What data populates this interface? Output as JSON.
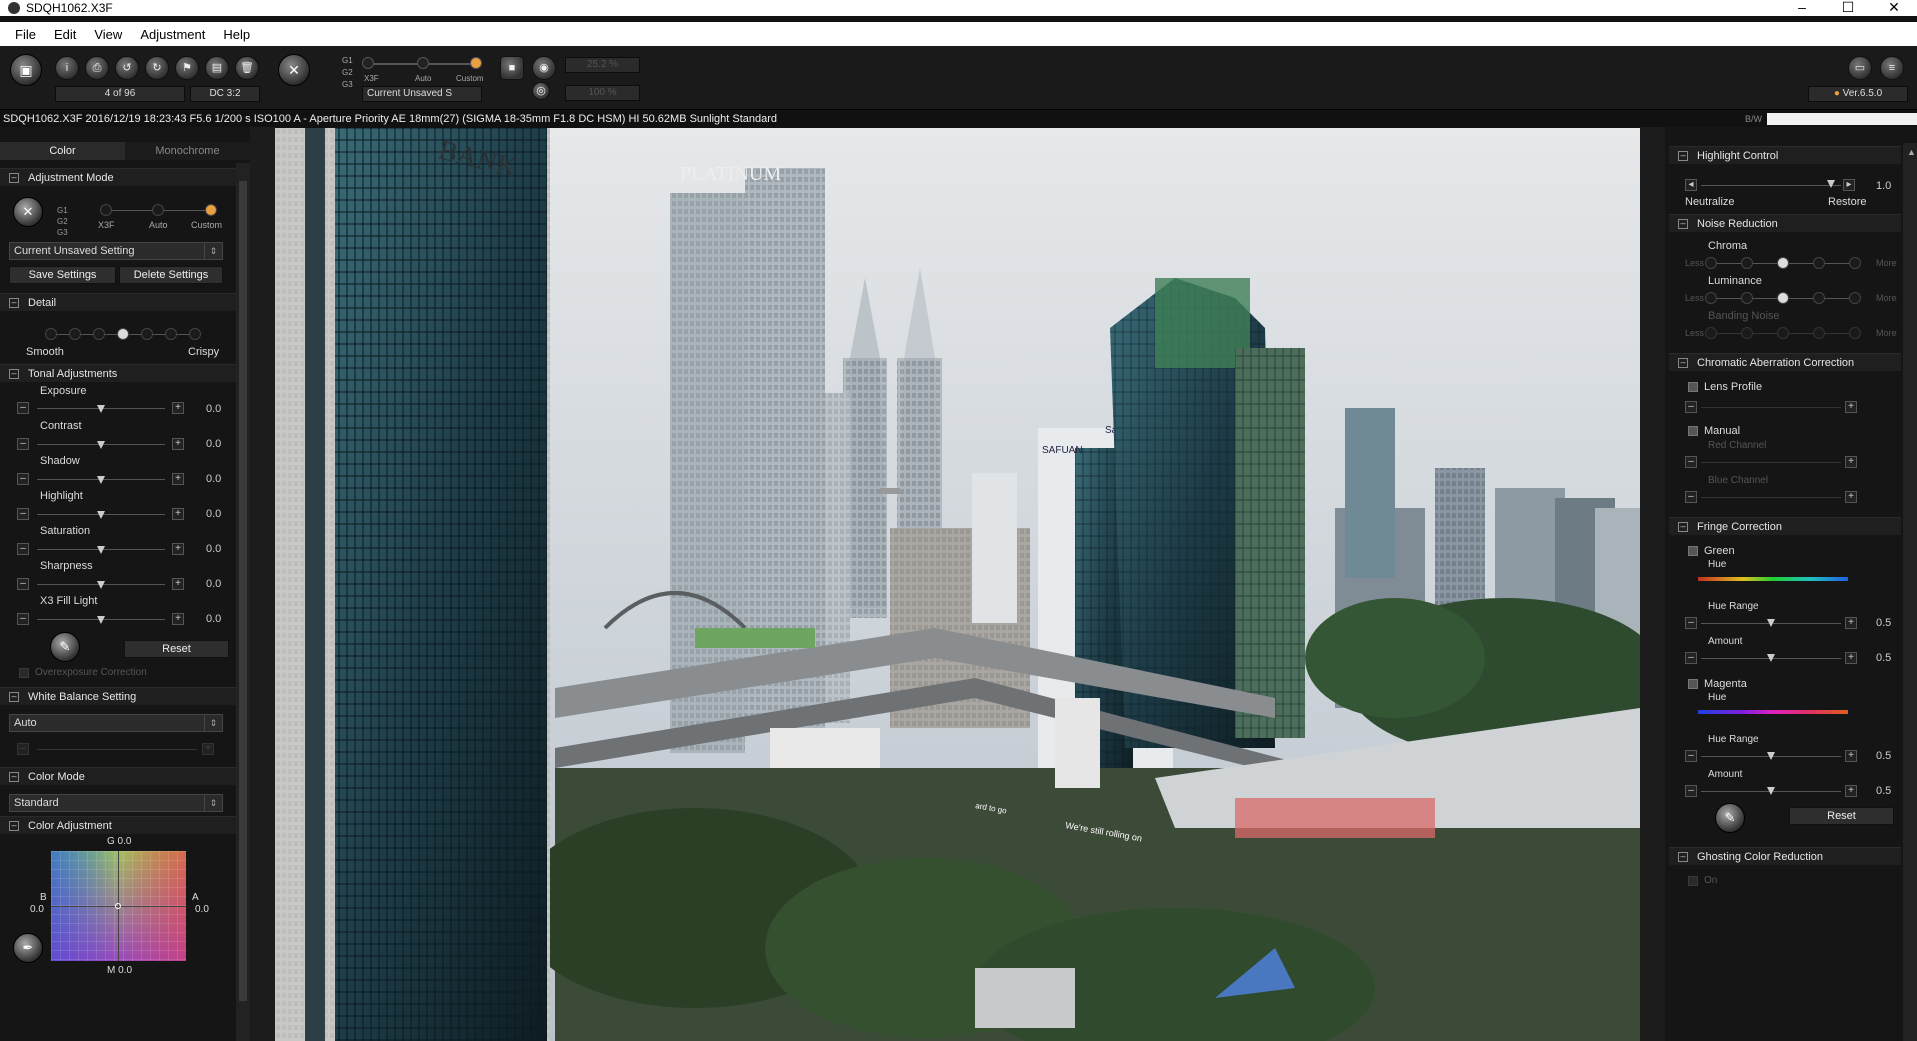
{
  "window": {
    "title": "SDQH1062.X3F",
    "controls": [
      "–",
      "☐",
      "✕"
    ]
  },
  "menu": [
    "File",
    "Edit",
    "View",
    "Adjustment",
    "Help"
  ],
  "toolbar": {
    "counter": "4 of 96",
    "aspect": "DC 3:2",
    "mode_labels": [
      "X3F",
      "Auto",
      "Custom"
    ],
    "g_labels": [
      "G1",
      "G2",
      "G3"
    ],
    "setting": "Current Unsaved S",
    "zoom1": "25.2 %",
    "zoom2": "100 %",
    "version": "Ver.6.5.0"
  },
  "info": {
    "text": "SDQH1062.X3F 2016/12/19 18:23:43 F5.6 1/200 s ISO100 A - Aperture Priority AE 18mm(27) (SIGMA 18-35mm F1.8 DC HSM) HI 50.62MB Sunlight Standard",
    "bw_label": "B/W"
  },
  "left": {
    "tabs": [
      "Color",
      "Monochrome"
    ],
    "adjustment_mode": {
      "title": "Adjustment Mode",
      "g_labels": [
        "G1",
        "G2",
        "G3"
      ],
      "labels": [
        "X3F",
        "Auto",
        "Custom"
      ],
      "setting": "Current Unsaved Setting",
      "save": "Save Settings",
      "delete": "Delete Settings"
    },
    "detail": {
      "title": "Detail",
      "smooth": "Smooth",
      "crispy": "Crispy"
    },
    "tonal": {
      "title": "Tonal Adjustments",
      "items": [
        {
          "label": "Exposure",
          "value": "0.0"
        },
        {
          "label": "Contrast",
          "value": "0.0"
        },
        {
          "label": "Shadow",
          "value": "0.0"
        },
        {
          "label": "Highlight",
          "value": "0.0"
        },
        {
          "label": "Saturation",
          "value": "0.0"
        },
        {
          "label": "Sharpness",
          "value": "0.0"
        },
        {
          "label": "X3 Fill Light",
          "value": "0.0"
        }
      ],
      "reset": "Reset",
      "overexposure": "Overexposure Correction"
    },
    "wb": {
      "title": "White Balance Setting",
      "value": "Auto"
    },
    "color_mode": {
      "title": "Color Mode",
      "value": "Standard"
    },
    "color_adj": {
      "title": "Color Adjustment",
      "g_label": "G 0.0",
      "b_label": "B",
      "b_value": "0.0",
      "a_label": "A",
      "a_value": "0.0",
      "m_label": "M 0.0"
    }
  },
  "right": {
    "highlight": {
      "title": "Highlight Control",
      "value": "1.0",
      "neutralize": "Neutralize",
      "restore": "Restore"
    },
    "noise": {
      "title": "Noise Reduction",
      "chroma": "Chroma",
      "luminance": "Luminance",
      "banding": "Banding Noise",
      "less": "Less",
      "more": "More"
    },
    "chromatic": {
      "title": "Chromatic Aberration Correction",
      "lens": "Lens Profile",
      "manual": "Manual",
      "red": "Red Channel",
      "blue": "Blue Channel"
    },
    "fringe": {
      "title": "Fringe Correction",
      "green": "Green",
      "magenta": "Magenta",
      "hue": "Hue",
      "hue_range": "Hue Range",
      "amount": "Amount",
      "g_range_val": "0.5",
      "g_amount_val": "0.5",
      "m_range_val": "0.5",
      "m_amount_val": "0.5",
      "reset": "Reset"
    },
    "ghosting": {
      "title": "Ghosting Color Reduction",
      "on": "On"
    }
  },
  "photo": {
    "signs": [
      "BANK",
      "PLATINUM",
      "SAFUAN",
      "Safuan",
      "We're still rolling on",
      "ard to go"
    ]
  },
  "colors": {
    "accent": "#e8a040",
    "panel": "#151515",
    "header": "#1f1f1f"
  }
}
